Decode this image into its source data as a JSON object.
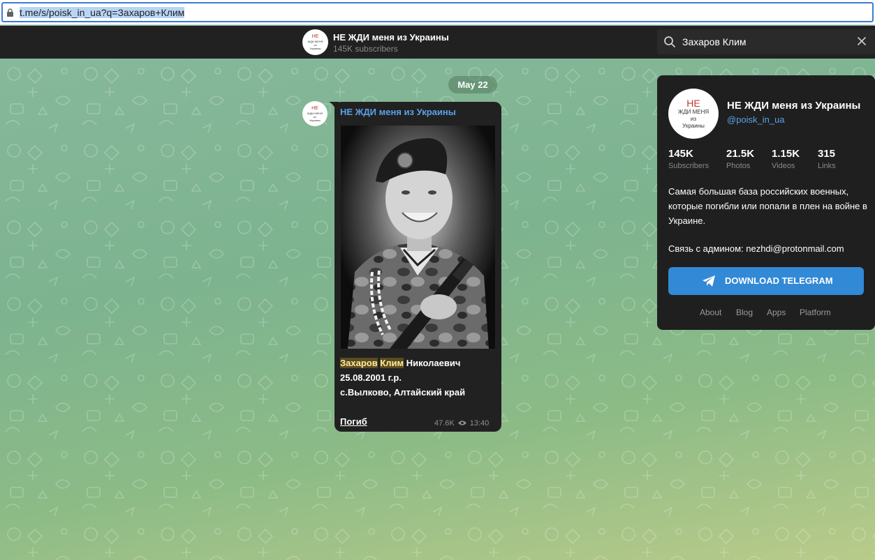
{
  "browser": {
    "url": "t.me/s/poisk_in_ua?q=Захаров+Клим"
  },
  "header": {
    "channel_title": "НЕ ЖДИ меня из Украины",
    "subscribers": "145K subscribers",
    "search_value": "Захаров Клим"
  },
  "logo": {
    "line1": "НЕ",
    "line2": "ЖДИ МЕНЯ",
    "line3": "из",
    "line4": "Украины"
  },
  "feed": {
    "date": "May 22",
    "message": {
      "author": "НЕ ЖДИ меня из Украины",
      "name_hl1": "Захаров",
      "name_hl2": "Клим",
      "name_rest": "Николаевич",
      "birth": "25.08.2001 г.р.",
      "place": "с.Вылково, Алтайский край",
      "status_link": "Погиб",
      "views": "47.6K",
      "time": "13:40"
    }
  },
  "channel_card": {
    "title": "НЕ ЖДИ меня из Украины",
    "handle": "@poisk_in_ua",
    "stats": [
      {
        "value": "145K",
        "label": "Subscribers"
      },
      {
        "value": "21.5K",
        "label": "Photos"
      },
      {
        "value": "1.15K",
        "label": "Videos"
      },
      {
        "value": "315",
        "label": "Links"
      }
    ],
    "description": "Самая большая база российских военных, которые погибли или попали в плен на войне в Украине.",
    "contact": "Связь с админом: nezhdi@protonmail.com",
    "download_label": "DOWNLOAD TELEGRAM",
    "footer_links": [
      "About",
      "Blog",
      "Apps",
      "Platform"
    ]
  },
  "colors": {
    "accent": "#3289d6",
    "link": "#5aa2e6",
    "dark_surface": "#212121"
  }
}
